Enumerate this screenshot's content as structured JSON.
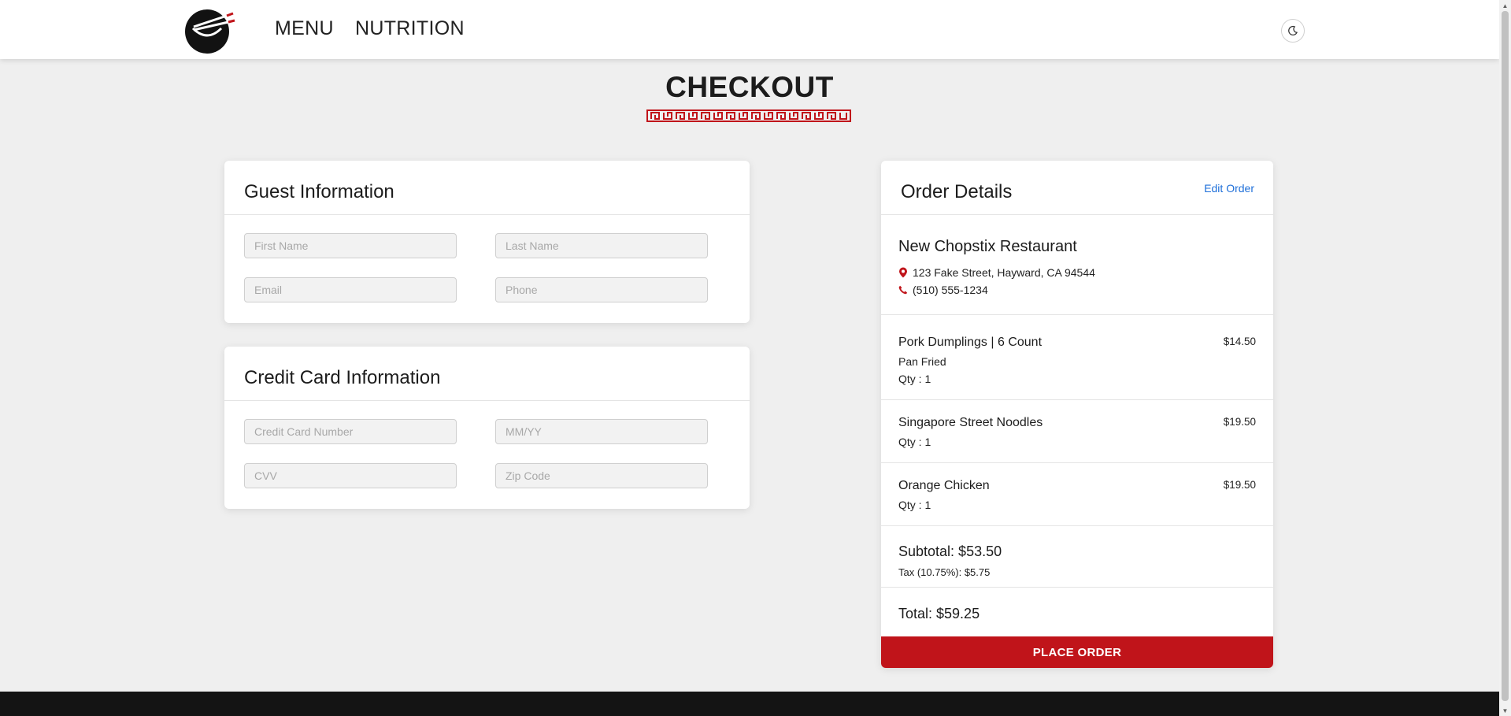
{
  "header": {
    "nav": [
      {
        "label": "MENU"
      },
      {
        "label": "NUTRITION"
      }
    ],
    "icons": {
      "logo": "chopstix-bowl-logo",
      "theme_toggle": "moon-icon"
    }
  },
  "page": {
    "title": "CHECKOUT"
  },
  "guest": {
    "title": "Guest Information",
    "first_name_placeholder": "First Name",
    "last_name_placeholder": "Last Name",
    "email_placeholder": "Email",
    "phone_placeholder": "Phone"
  },
  "credit_card": {
    "title": "Credit Card Information",
    "number_placeholder": "Credit Card Number",
    "expiry_placeholder": "MM/YY",
    "cvv_placeholder": "CVV",
    "zip_placeholder": "Zip Code"
  },
  "order": {
    "title": "Order Details",
    "edit_label": "Edit Order",
    "restaurant": {
      "name": "New Chopstix Restaurant",
      "address": "123 Fake Street, Hayward, CA 94544",
      "phone": "(510) 555-1234"
    },
    "items": [
      {
        "name": "Pork Dumplings | 6 Count",
        "option": "Pan Fried",
        "qty": "Qty : 1",
        "price": "$14.50"
      },
      {
        "name": "Singapore Street Noodles",
        "qty": "Qty : 1",
        "price": "$19.50"
      },
      {
        "name": "Orange Chicken",
        "qty": "Qty : 1",
        "price": "$19.50"
      }
    ],
    "subtotal": "Subtotal: $53.50",
    "tax": "Tax (10.75%): $5.75",
    "total": "Total: $59.25",
    "place_order_label": "PLACE ORDER"
  },
  "colors": {
    "accent_red": "#c0141a",
    "link_blue": "#1e6fd9",
    "background": "#efefef",
    "footer": "#141414"
  }
}
